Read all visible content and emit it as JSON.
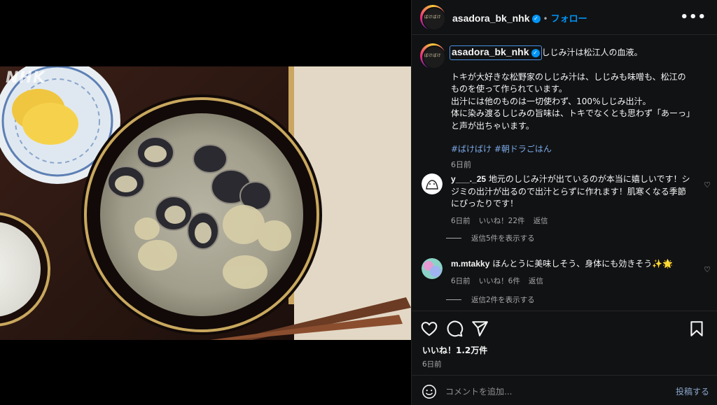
{
  "media": {
    "watermark": "NHK"
  },
  "header": {
    "avatar_text": "ばけばけ",
    "username": "asadora_bk_nhk",
    "separator": "•",
    "follow_label": "フォロー",
    "more_icon": "more-horizontal-icon"
  },
  "caption": {
    "username": "asadora_bk_nhk",
    "first_line": "しじみ汁は松江人の血液。",
    "lines": [
      "トキが大好きな松野家のしじみ汁は、しじみも味噌も、松江の",
      "ものを使って作られています。",
      "出汁には他のものは一切使わず、100%しじみ出汁。",
      "体に染み渡るしじみの旨味は、トキでなくとも思わず「あーっ」",
      "と声が出ちゃいます。"
    ],
    "hashtags": "#ばけばけ #朝ドラごはん",
    "time": "6日前"
  },
  "comments": [
    {
      "username": "y___._25",
      "text": "地元のしじみ汁が出ているのが本当に嬉しいです！シジミの出汁が出るので出汁とらずに作れます！肌寒くなる季節にぴったりです！",
      "time": "6日前",
      "likes": "いいね！22件",
      "reply": "返信",
      "view_replies": "返信5件を表示する"
    },
    {
      "username": "m.mtakky",
      "text": "ほんとうに美味しそう、身体にも効きそう✨🌟",
      "time": "6日前",
      "likes": "いいね！6件",
      "reply": "返信",
      "view_replies": "返信2件を表示する"
    }
  ],
  "actions": {
    "likes": "いいね！1.2万件",
    "date": "6日前",
    "icons": [
      "heart-icon",
      "comment-icon",
      "share-icon",
      "bookmark-icon"
    ]
  },
  "composer": {
    "placeholder": "コメントを追加...",
    "post_label": "投稿する"
  },
  "colors": {
    "panel_bg": "#111214",
    "link_blue": "#0095f6",
    "hashtag": "#7aa9e6",
    "muted": "#a8a8a8"
  }
}
